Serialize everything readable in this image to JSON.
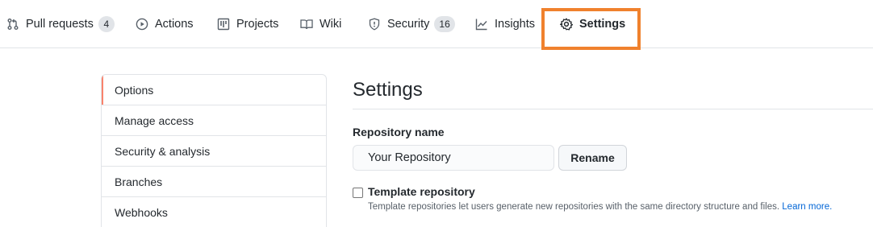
{
  "nav": {
    "tabs": [
      {
        "label": "Pull requests",
        "counter": "4",
        "icon": "git-pull-request-icon"
      },
      {
        "label": "Actions",
        "icon": "play-icon"
      },
      {
        "label": "Projects",
        "icon": "project-icon"
      },
      {
        "label": "Wiki",
        "icon": "book-icon"
      },
      {
        "label": "Security",
        "counter": "16",
        "icon": "shield-icon"
      },
      {
        "label": "Insights",
        "icon": "graph-icon"
      },
      {
        "label": "Settings",
        "icon": "gear-icon",
        "selected": true
      }
    ],
    "highlight_color": "#f0812d"
  },
  "sidebar": {
    "items": [
      {
        "label": "Options",
        "active": true
      },
      {
        "label": "Manage access"
      },
      {
        "label": "Security & analysis"
      },
      {
        "label": "Branches"
      },
      {
        "label": "Webhooks"
      }
    ],
    "active_color": "#f9826c"
  },
  "main": {
    "title": "Settings",
    "repo_name_label": "Repository name",
    "repo_name_value": "Your Repository",
    "rename_label": "Rename",
    "template": {
      "label": "Template repository",
      "checked": false,
      "description": "Template repositories let users generate new repositories with the same directory structure and files.",
      "learn_more": "Learn more."
    }
  },
  "colors": {
    "link": "#0366d6",
    "text": "#24292e",
    "muted": "#586069"
  }
}
